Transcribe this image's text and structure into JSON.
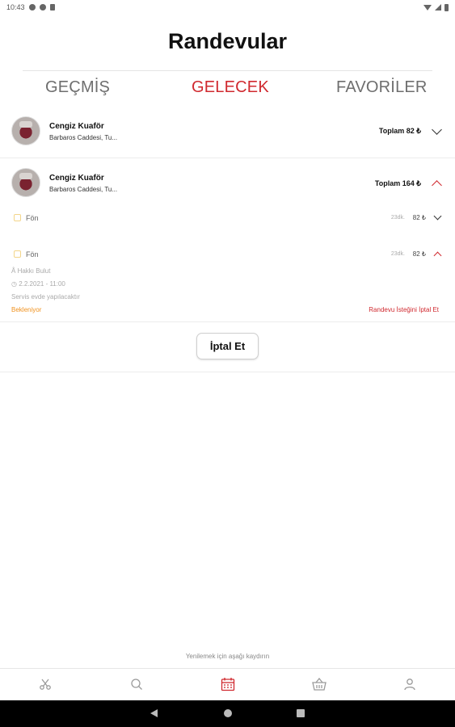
{
  "status_bar": {
    "time": "10:43"
  },
  "header": {
    "title": "Randevular"
  },
  "tabs": [
    {
      "label": "GEÇMİŞ",
      "active": false
    },
    {
      "label": "GELECEK",
      "active": true
    },
    {
      "label": "FAVORİLER",
      "active": false
    }
  ],
  "appointments": [
    {
      "shop_name": "Cengiz Kuaför",
      "address": "Barbaros Caddesi, Tu...",
      "total": "Toplam 82 ₺",
      "expanded": false
    },
    {
      "shop_name": "Cengiz Kuaför",
      "address": "Barbaros Caddesi, Tu...",
      "total": "Toplam 164 ₺",
      "expanded": true,
      "services": [
        {
          "name": "Fön",
          "duration": "23dk.",
          "price": "82 ₺",
          "expanded": false
        },
        {
          "name": "Fön",
          "duration": "23dk.",
          "price": "82 ₺",
          "expanded": true,
          "staff": "Hakkı Bulut",
          "datetime": "2.2.2021 - 11:00",
          "note": "Servis evde yapılacaktır",
          "status": "Bekleniyor",
          "cancel_request_label": "Randevu İsteğini İptal Et"
        }
      ],
      "cancel_button_label": "İptal Et"
    }
  ],
  "refresh_hint": "Yenilemek için aşağı kaydırın",
  "bottom_nav": [
    {
      "icon": "scissors-icon",
      "active": false
    },
    {
      "icon": "search-icon",
      "active": false
    },
    {
      "icon": "calendar-icon",
      "active": true
    },
    {
      "icon": "basket-icon",
      "active": false
    },
    {
      "icon": "profile-icon",
      "active": false
    }
  ],
  "colors": {
    "accent": "#d0292f",
    "pending": "#f0921f"
  }
}
